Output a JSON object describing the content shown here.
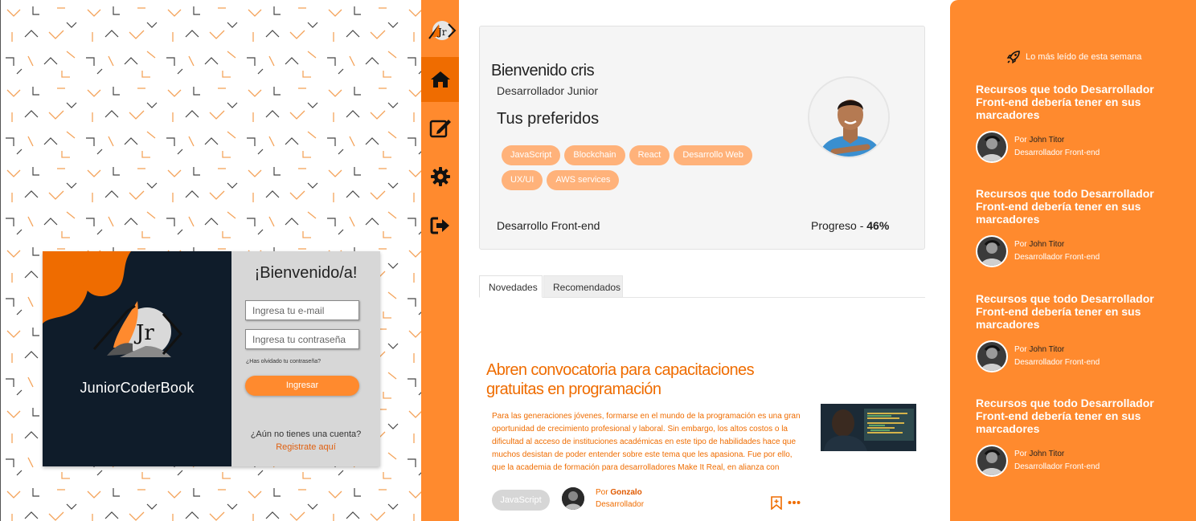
{
  "login": {
    "brand": "JuniorCoderBook",
    "welcome": "¡Bienvenido/a!",
    "email_placeholder": "Ingresa tu e-mail",
    "password_placeholder": "Ingresa tu contraseña",
    "forgot": "¿Has olvidado tu contraseña?",
    "submit": "Ingresar",
    "no_account": "¿Aún no tienes una cuenta?",
    "register": "Registrate aquí"
  },
  "sidebar": {
    "logo_letters": "Jr",
    "items": [
      {
        "icon": "home-icon",
        "active": true
      },
      {
        "icon": "edit-icon",
        "active": false
      },
      {
        "icon": "gear-icon",
        "active": false
      },
      {
        "icon": "logout-icon",
        "active": false
      }
    ]
  },
  "profile": {
    "greeting": "Bienvenido cris",
    "role": "Desarrollador Junior",
    "favorites_title": "Tus preferidos",
    "favorites": [
      "JavaScript",
      "Blockchain",
      "React",
      "Desarrollo Web",
      "UX/UI",
      "AWS services"
    ],
    "track": "Desarrollo Front-end",
    "progress_label": "Progreso - ",
    "progress_value": "46%"
  },
  "tabs": [
    "Novedades",
    "Recomendados"
  ],
  "article": {
    "title": "Abren convocatoria para capacitaciones gratuitas en programación",
    "excerpt": "Para las generaciones jóvenes, formarse en el mundo de la programación es una gran oportunidad de crecimiento profesional y laboral. Sin embargo, los altos costos o la dificultad al acceso de instituciones académicas en este tipo de habilidades hace que muchos desistan de poder entender sobre este tema que les apasiona. Fue por ello, que la academia de formación para desarrolladores Make It Real, en alianza con",
    "tag": "JavaScript",
    "by_prefix": "Por ",
    "author": "Gonzalo",
    "author_role": "Desarrollador"
  },
  "weekly": {
    "heading": "Lo más leído de esta semana",
    "items": [
      {
        "title": "Recursos que todo Desarrollador Front-end debería tener en sus marcadores",
        "by_prefix": "Por ",
        "author": "John Titor",
        "role": "Desarrollador Front-end"
      },
      {
        "title": "Recursos que todo Desarrollador Front-end debería tener en sus marcadores",
        "by_prefix": "Por ",
        "author": "John Titor",
        "role": "Desarrollador Front-end"
      },
      {
        "title": "Recursos que todo Desarrollador Front-end debería tener en sus marcadores",
        "by_prefix": "Por ",
        "author": "John Titor",
        "role": "Desarrollador Front-end"
      },
      {
        "title": "Recursos que todo Desarrollador Front-end debería tener en sus marcadores",
        "by_prefix": "Por ",
        "author": "John Titor",
        "role": "Desarrollador Front-end"
      }
    ]
  },
  "colors": {
    "accent": "#ff8a2e",
    "accent_dark": "#ef6c00",
    "navy": "#0f1c2a",
    "chip": "#ffb27a"
  }
}
